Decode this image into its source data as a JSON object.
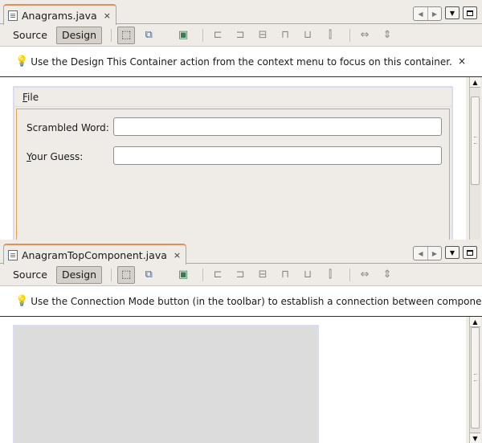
{
  "editors": [
    {
      "tab_title": "Anagrams.java",
      "tab_close": "×",
      "source_label": "Source",
      "design_label": "Design",
      "hint": "Use the Design This Container action from the context menu to focus on this container.",
      "hint_close": "×",
      "menu": {
        "file_mnemonic": "F",
        "file_rest": "ile"
      },
      "form": {
        "scrambled_label": "Scrambled Word:",
        "guess_mnemonic": "Y",
        "guess_rest": "our Guess:",
        "scrambled_value": "",
        "guess_value": ""
      }
    },
    {
      "tab_title": "AnagramTopComponent.java",
      "tab_close": "×",
      "source_label": "Source",
      "design_label": "Design",
      "hint": "Use the Connection Mode button (in the toolbar) to establish a connection between components."
    }
  ],
  "icons": {
    "nav_left": "◀",
    "nav_right": "▶",
    "nav_down": "▼",
    "scroll_up": "▲",
    "scroll_down": "▼",
    "bulb": "💡",
    "selection_mode": "⬚",
    "connection_mode": "⧉",
    "preview_design": "▣",
    "align_left": "⊏",
    "align_right": "⊐",
    "center_horizontally": "⊟",
    "align_top": "⊓",
    "align_bottom": "⊔",
    "center_vertically": "⫿",
    "resize_horizontal": "⇔",
    "resize_vertical": "⇕"
  }
}
